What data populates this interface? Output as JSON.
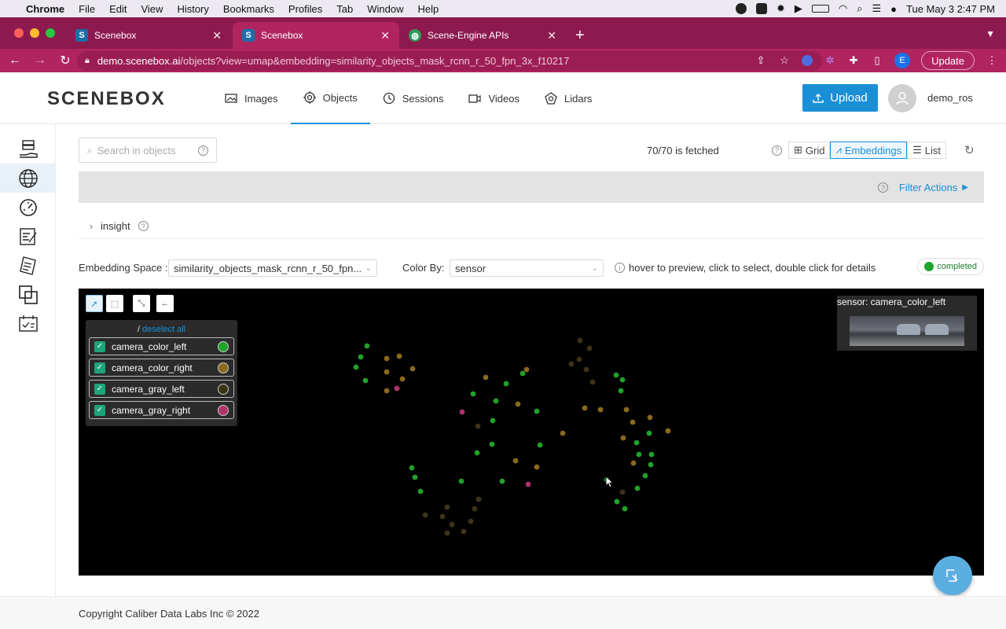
{
  "menubar": {
    "app": "Chrome",
    "items": [
      "File",
      "Edit",
      "View",
      "History",
      "Bookmarks",
      "Profiles",
      "Tab",
      "Window",
      "Help"
    ],
    "datetime": "Tue May 3  2:47 PM"
  },
  "tabs": [
    {
      "label": "Scenebox",
      "favicon": "S",
      "active": false
    },
    {
      "label": "Scenebox",
      "favicon": "S",
      "active": true
    },
    {
      "label": "Scene-Engine APIs",
      "favicon": "globe",
      "active": false
    }
  ],
  "address": {
    "host": "demo.scenebox.ai",
    "path": "/objects?view=umap&embedding=similarity_objects_mask_rcnn_r_50_fpn_3x_f10217",
    "profile_initial": "E",
    "update_label": "Update"
  },
  "header": {
    "logo": "SCENEBOX",
    "nav": [
      {
        "label": "Images",
        "icon": "image-icon"
      },
      {
        "label": "Objects",
        "icon": "target-icon"
      },
      {
        "label": "Sessions",
        "icon": "clock-icon"
      },
      {
        "label": "Videos",
        "icon": "video-icon"
      },
      {
        "label": "Lidars",
        "icon": "lidar-icon"
      }
    ],
    "upload_label": "Upload",
    "user": "demo_ros"
  },
  "toolbar": {
    "search_placeholder": "Search in objects",
    "fetched": "70/70 is fetched",
    "views": [
      "Grid",
      "Embeddings",
      "List"
    ],
    "active_view": "Embeddings"
  },
  "filter": {
    "actions_label": "Filter Actions"
  },
  "insight": {
    "label": "insight"
  },
  "controls": {
    "embedding_label": "Embedding Space :",
    "embedding_value": "similarity_objects_mask_rcnn_r_50_fpn...",
    "color_label": "Color By:",
    "color_value": "sensor",
    "hint": "hover to preview, click to select, double click for details",
    "status": "completed"
  },
  "legend": {
    "slash": "/",
    "deselect": "deselect all",
    "items": [
      {
        "label": "camera_color_left",
        "color": "#1fa327"
      },
      {
        "label": "camera_color_right",
        "color": "#8a6a1e"
      },
      {
        "label": "camera_gray_left",
        "color": "#3d3418"
      },
      {
        "label": "camera_gray_right",
        "color": "#b0336a"
      }
    ]
  },
  "preview": {
    "title": "sensor: camera_color_left"
  },
  "colors": {
    "accent": "#1a8fd6",
    "tab_bg": "#8d1a4e",
    "tab_active": "#b0245f"
  },
  "footer": {
    "copyright": "Copyright Caliber Data Labs Inc © 2022"
  }
}
